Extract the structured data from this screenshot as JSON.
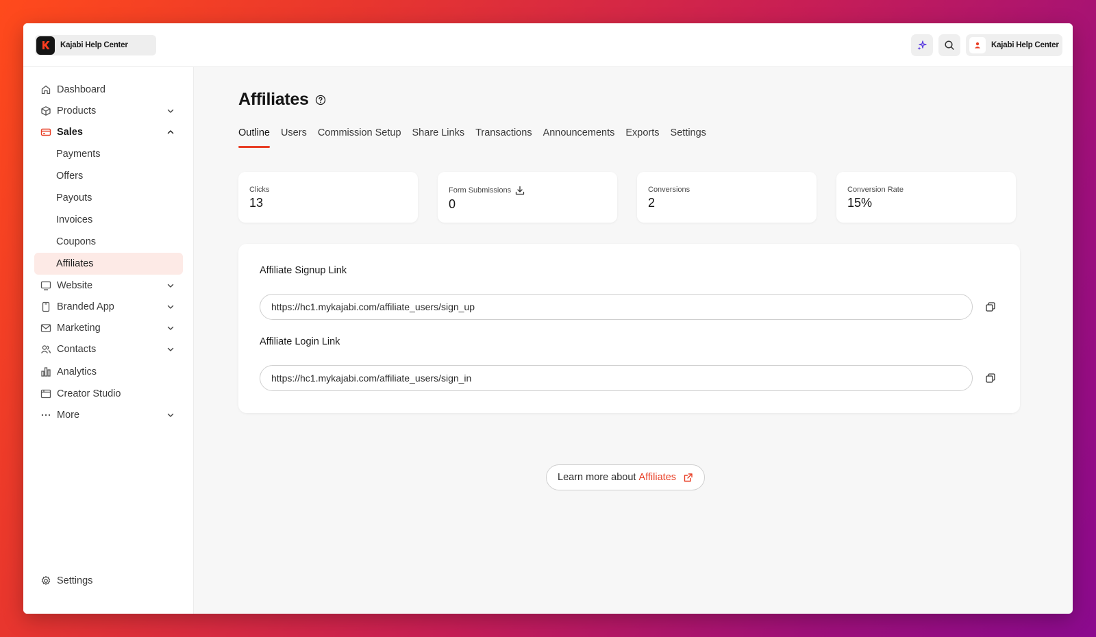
{
  "topbar": {
    "brand_name": "Kajabi Help Center",
    "user_name": "Kajabi Help Center",
    "icons": {
      "ai": "sparkles-icon",
      "search": "search-icon"
    }
  },
  "sidebar": {
    "items": [
      {
        "label": "Dashboard",
        "icon": "home-icon"
      },
      {
        "label": "Products",
        "icon": "box-icon"
      },
      {
        "label": "Sales",
        "icon": "credit-card-icon"
      },
      {
        "label": "Payments"
      },
      {
        "label": "Offers"
      },
      {
        "label": "Payouts"
      },
      {
        "label": "Invoices"
      },
      {
        "label": "Coupons"
      },
      {
        "label": "Affiliates"
      },
      {
        "label": "Website",
        "icon": "monitor-icon"
      },
      {
        "label": "Branded App",
        "icon": "phone-icon"
      },
      {
        "label": "Marketing",
        "icon": "mail-icon"
      },
      {
        "label": "Contacts",
        "icon": "users-icon"
      },
      {
        "label": "Analytics",
        "icon": "chart-icon"
      },
      {
        "label": "Creator Studio",
        "icon": "calendar-icon"
      },
      {
        "label": "More",
        "icon": "dots-icon"
      }
    ],
    "settings_label": "Settings"
  },
  "page": {
    "title": "Affiliates",
    "tabs": [
      "Outline",
      "Users",
      "Commission Setup",
      "Share Links",
      "Transactions",
      "Announcements",
      "Exports",
      "Settings"
    ],
    "active_tab": "Outline"
  },
  "stats": [
    {
      "label": "Clicks",
      "value": "13"
    },
    {
      "label": "Form Submissions",
      "value": "0"
    },
    {
      "label": "Conversions",
      "value": "2"
    },
    {
      "label": "Conversion Rate",
      "value": "15%"
    }
  ],
  "links": {
    "signup_title": "Affiliate Signup Link",
    "signup_url": "https://hc1.mykajabi.com/affiliate_users/sign_up",
    "login_title": "Affiliate Login Link",
    "login_url": "https://hc1.mykajabi.com/affiliate_users/sign_in"
  },
  "learn_more": {
    "prefix": "Learn more about",
    "link": "Affiliates"
  },
  "colors": {
    "accent": "#e83e25",
    "selected_bg": "#fdeae6"
  }
}
